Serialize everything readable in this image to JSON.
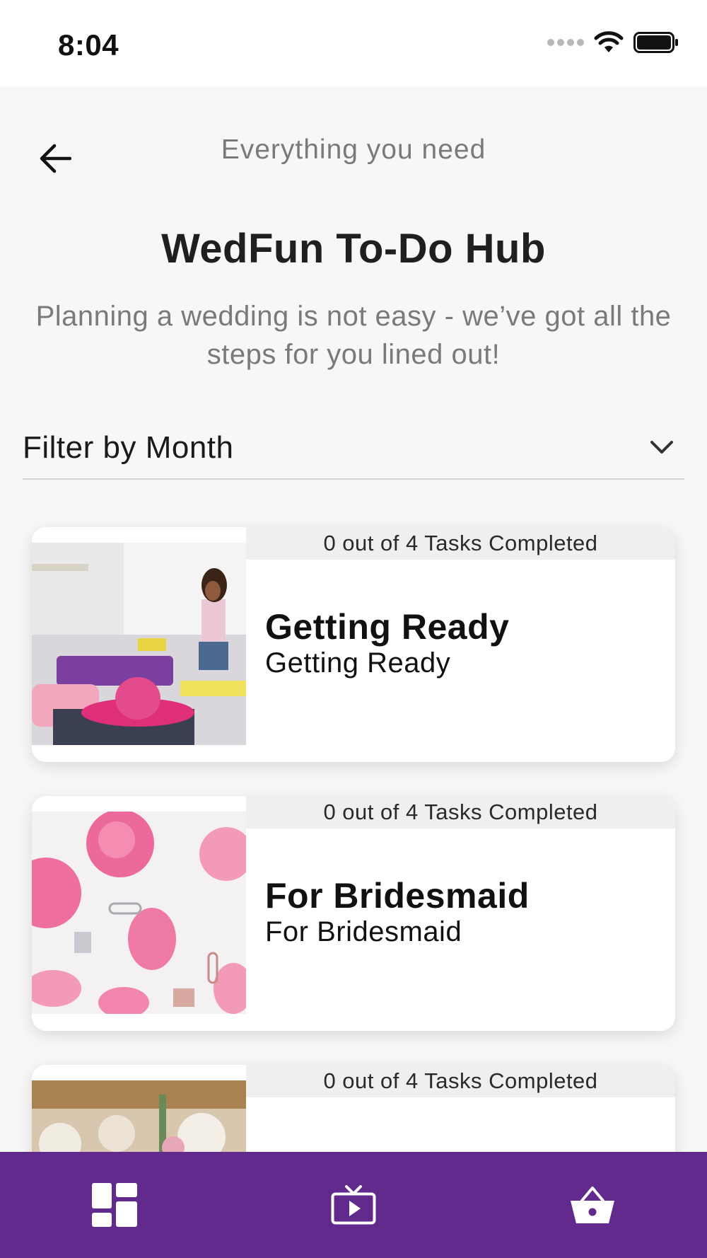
{
  "status_bar": {
    "time": "8:04"
  },
  "header": {
    "subtitle": "Everything you need",
    "back_icon": "arrow-left-icon"
  },
  "page": {
    "title": "WedFun To-Do Hub",
    "description": "Planning a wedding is not easy - we’ve got all the steps for you lined out!"
  },
  "filter": {
    "label": "Filter by Month",
    "icon": "chevron-down-icon"
  },
  "cards": [
    {
      "progress": "0 out of 4 Tasks Completed",
      "title": "Getting Ready",
      "subtitle": "Getting Ready"
    },
    {
      "progress": "0 out of 4 Tasks Completed",
      "title": "For Bridesmaid",
      "subtitle": "For Bridesmaid"
    },
    {
      "progress": "0 out of 4 Tasks Completed",
      "title": "",
      "subtitle": ""
    }
  ],
  "bottom_nav": {
    "items": [
      {
        "icon": "dashboard-icon"
      },
      {
        "icon": "video-play-icon"
      },
      {
        "icon": "basket-icon"
      }
    ]
  },
  "colors": {
    "nav_background": "#632a8e",
    "page_background": "#f7f7f7"
  }
}
